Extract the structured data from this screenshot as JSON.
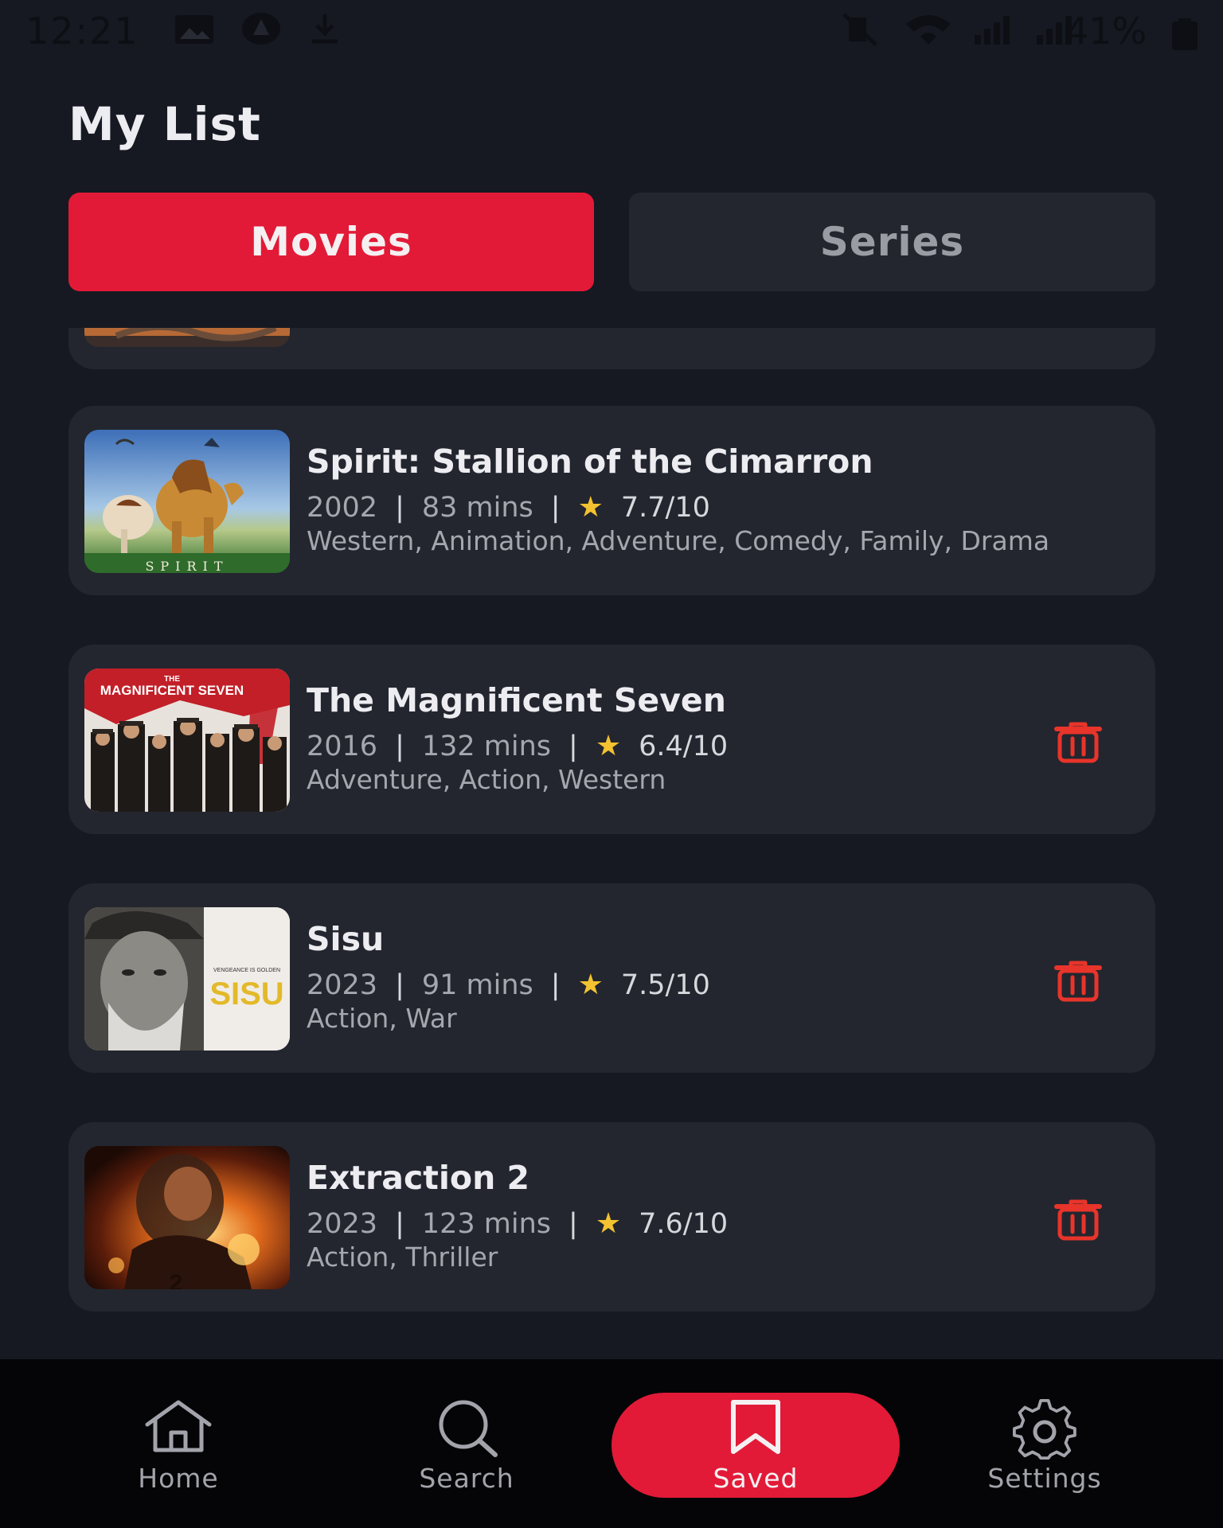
{
  "status_bar": {
    "time": "12:21",
    "battery": "41%"
  },
  "page": {
    "title": "My List"
  },
  "tabs": [
    {
      "label": "Movies",
      "active": true
    },
    {
      "label": "Series",
      "active": false
    }
  ],
  "movies": [
    {
      "title": "Spirit: Stallion of the Cimarron",
      "year": "2002",
      "runtime": "83 mins",
      "rating": "7.7/10",
      "genres": "Western, Animation, Adventure, Comedy, Family, Drama",
      "poster_icon": "spirit-poster",
      "has_delete": false
    },
    {
      "title": "The Magnificent Seven",
      "year": "2016",
      "runtime": "132 mins",
      "rating": "6.4/10",
      "genres": "Adventure, Action, Western",
      "poster_icon": "magnificent-seven-poster",
      "poster_text": "MAGNIFICENT SEVEN",
      "poster_small_text": "THE",
      "has_delete": true
    },
    {
      "title": "Sisu",
      "year": "2023",
      "runtime": "91 mins",
      "rating": "7.5/10",
      "genres": "Action, War",
      "poster_icon": "sisu-poster",
      "poster_text": "SISU",
      "has_delete": true
    },
    {
      "title": "Extraction 2",
      "year": "2023",
      "runtime": "123 mins",
      "rating": "7.6/10",
      "genres": "Action, Thriller",
      "poster_icon": "extraction-2-poster",
      "has_delete": true
    }
  ],
  "bottom_nav": [
    {
      "label": "Home",
      "icon": "home-icon",
      "active": false
    },
    {
      "label": "Search",
      "icon": "search-icon",
      "active": false
    },
    {
      "label": "Saved",
      "icon": "bookmark-icon",
      "active": true
    },
    {
      "label": "Settings",
      "icon": "gear-icon",
      "active": false
    }
  ],
  "colors": {
    "accent": "#e21a37",
    "background": "#161922",
    "card": "#23262f",
    "nav_background": "#050507",
    "star": "#f2c230"
  }
}
